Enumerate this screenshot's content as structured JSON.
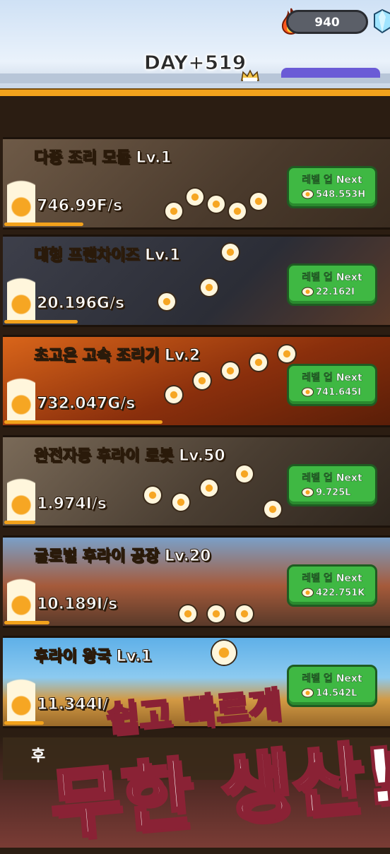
{
  "resources": {
    "fire_icon": "fire-icon",
    "fire_count": "940",
    "gem_icon": "diamond-icon"
  },
  "day_label": "DAY+519",
  "cards": [
    {
      "title": "다중 조리 모듈 Lv.1",
      "rate": "746.99F/s",
      "button_label": "레벨 업 Next",
      "button_cost": "548.553H",
      "progress": 0.21
    },
    {
      "title": "대형 프랜차이즈 Lv.1",
      "rate": "20.196G/s",
      "button_label": "레벨 업 Next",
      "button_cost": "22.162I",
      "progress": 0.19
    },
    {
      "title": "초고온 고속 조리기 Lv.2",
      "rate": "732.047G/s",
      "button_label": "레벨 업 Next",
      "button_cost": "741.645I",
      "progress": 0.41
    },
    {
      "title": "완전자동 후라이 로봇 Lv.50",
      "rate": "1.974I/s",
      "button_label": "레벨 업 Next",
      "button_cost": "9.725L",
      "progress": 0.08
    },
    {
      "title": "글로벌 후라이 공장 Lv.20",
      "rate": "10.189I/s",
      "button_label": "레벨 업 Next",
      "button_cost": "422.751K",
      "progress": 0.12
    },
    {
      "title": "후라이 왕국 Lv.1",
      "rate": "11.344I/",
      "button_label": "레벨 업 Next",
      "button_cost": "14.542L",
      "progress": 0.1
    }
  ],
  "last_card_title": "후",
  "promo": {
    "line1": "쉽고 빠르게",
    "line2": "무한 생산!"
  },
  "colors": {
    "accent_orange": "#f2a21c",
    "button_green": "#3fb843"
  }
}
